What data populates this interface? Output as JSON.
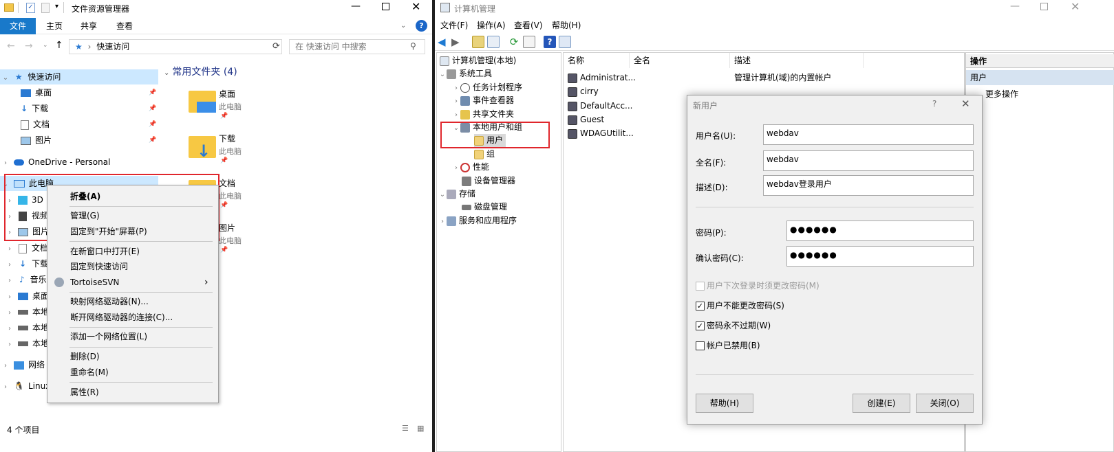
{
  "explorer": {
    "title": "文件资源管理器",
    "ribbon_tabs": [
      "文件",
      "主页",
      "共享",
      "查看"
    ],
    "address": "快速访问",
    "search_placeholder": "在 快速访问 中搜索",
    "nav": {
      "quick_access": "快速访问",
      "quick_items": [
        "桌面",
        "下载",
        "文档",
        "图片"
      ],
      "onedrive": "OneDrive - Personal",
      "this_pc": "此电脑",
      "pc_items": [
        "3D",
        "视频",
        "图片",
        "文档",
        "下载",
        "音乐",
        "桌面",
        "本地",
        "本地",
        "本地"
      ],
      "network": "网络",
      "linux": "Linux"
    },
    "section_title": "常用文件夹 (4)",
    "tiles": [
      {
        "name": "桌面",
        "sub": "此电脑"
      },
      {
        "name": "下载",
        "sub": "此电脑"
      },
      {
        "name": "文档",
        "sub": "此电脑"
      },
      {
        "name": "图片",
        "sub": "此电脑"
      }
    ],
    "status": "4 个项目"
  },
  "context_menu": {
    "items": [
      "折叠(A)",
      "管理(G)",
      "固定到\"开始\"屏幕(P)",
      "在新窗口中打开(E)",
      "固定到快速访问",
      "TortoiseSVN",
      "映射网络驱动器(N)...",
      "断开网络驱动器的连接(C)...",
      "添加一个网络位置(L)",
      "删除(D)",
      "重命名(M)",
      "属性(R)"
    ]
  },
  "mgmt": {
    "title": "计算机管理",
    "menu": [
      "文件(F)",
      "操作(A)",
      "查看(V)",
      "帮助(H)"
    ],
    "tree": [
      "计算机管理(本地)",
      "系统工具",
      "任务计划程序",
      "事件查看器",
      "共享文件夹",
      "本地用户和组",
      "用户",
      "组",
      "性能",
      "设备管理器",
      "存储",
      "磁盘管理",
      "服务和应用程序"
    ],
    "columns": [
      "名称",
      "全名",
      "描述"
    ],
    "users": [
      {
        "name": "Administrat...",
        "full": "",
        "desc": "管理计算机(域)的内置帐户"
      },
      {
        "name": "cirry",
        "full": "",
        "desc": ""
      },
      {
        "name": "DefaultAcc...",
        "full": "",
        "desc": ""
      },
      {
        "name": "Guest",
        "full": "",
        "desc": ""
      },
      {
        "name": "WDAGUtilit...",
        "full": "",
        "desc": ""
      }
    ],
    "actions_title": "操作",
    "actions_section": "用户",
    "actions_more": "更多操作"
  },
  "dialog": {
    "title": "新用户",
    "help_glyph": "?",
    "username_label": "用户名(U):",
    "username": "webdav",
    "fullname_label": "全名(F):",
    "fullname": "webdav",
    "desc_label": "描述(D):",
    "desc": "webdav登录用户",
    "password_label": "密码(P):",
    "password": "●●●●●●",
    "confirm_label": "确认密码(C):",
    "confirm": "●●●●●●",
    "chk_must_change": "用户下次登录时须更改密码(M)",
    "chk_cannot_change": "用户不能更改密码(S)",
    "chk_never_expire": "密码永不过期(W)",
    "chk_disabled": "帐户已禁用(B)",
    "btn_help": "帮助(H)",
    "btn_create": "创建(E)",
    "btn_close": "关闭(O)",
    "checked": [
      false,
      true,
      true,
      false
    ]
  },
  "colors": {
    "accent": "#1979ca",
    "highlight": "#e0262c",
    "selection": "#cce8ff"
  }
}
